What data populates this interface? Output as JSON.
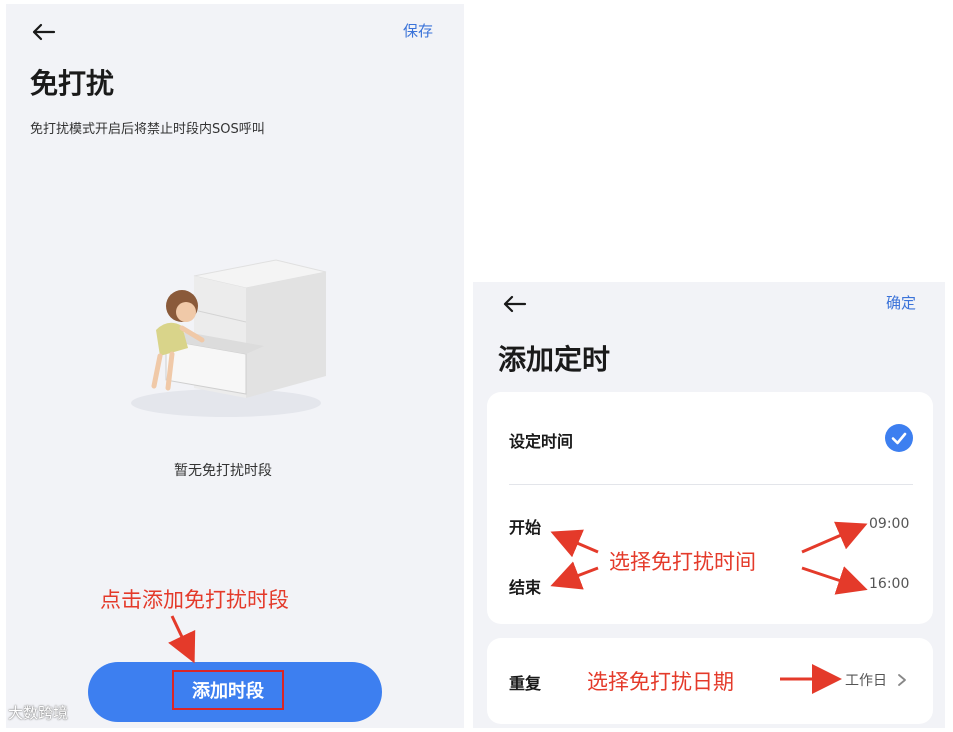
{
  "left": {
    "save_label": "保存",
    "title": "免打扰",
    "subtitle": "免打扰模式开启后将禁止时段内SOS呼叫",
    "empty_text": "暂无免打扰时段",
    "add_button_label": "添加时段",
    "annotation": "点击添加免打扰时段"
  },
  "right": {
    "confirm_label": "确定",
    "title": "添加定时",
    "set_time_label": "设定时间",
    "start_label": "开始",
    "start_time": "09:00",
    "end_label": "结束",
    "end_time": "16:00",
    "repeat_label": "重复",
    "repeat_value": "工作日",
    "annotation_time": "选择免打扰时间",
    "annotation_date": "选择免打扰日期"
  },
  "watermark": "大数跨境",
  "colors": {
    "accent": "#3d7ff0",
    "annotation": "#e43a2a",
    "background": "#f2f3f7"
  },
  "icons": [
    "back-arrow-icon",
    "check-circle-icon",
    "chevron-right-icon"
  ]
}
